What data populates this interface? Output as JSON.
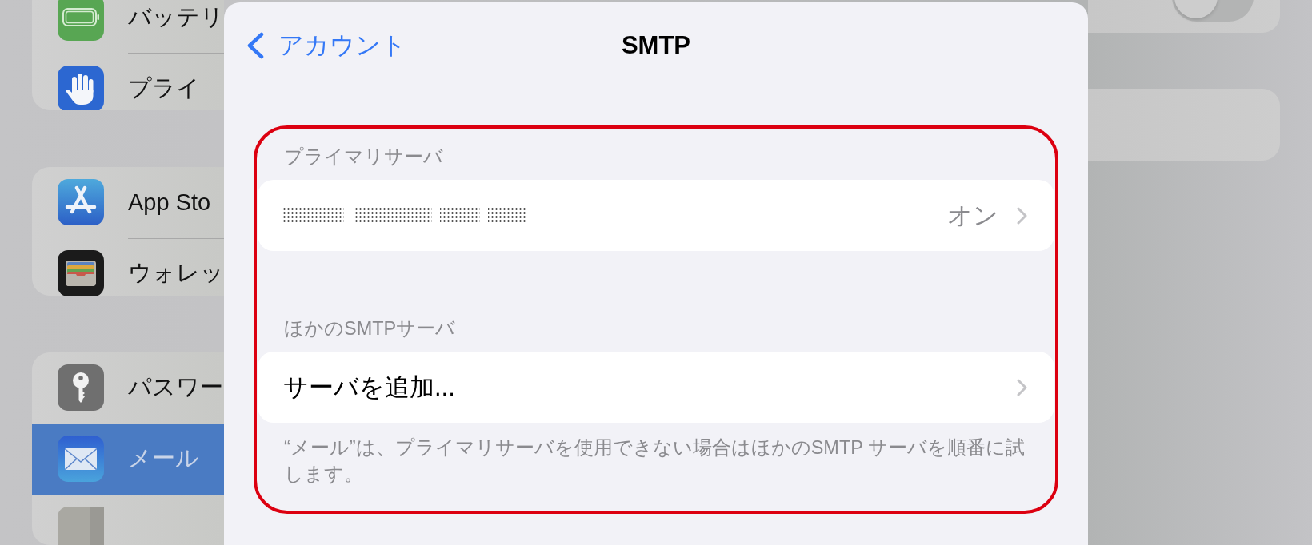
{
  "sidebar": {
    "groups": [
      {
        "items": [
          {
            "label": "バッテリ",
            "selected": false
          },
          {
            "label": "プライ",
            "selected": false
          }
        ]
      },
      {
        "items": [
          {
            "label": "App Sto",
            "selected": false
          },
          {
            "label": "ウォレッ",
            "selected": false
          }
        ]
      },
      {
        "items": [
          {
            "label": "パスワー",
            "selected": false
          },
          {
            "label": "メール",
            "selected": true
          },
          {
            "selected": false
          }
        ]
      }
    ]
  },
  "sheet": {
    "back_button": {
      "label": "アカウント"
    },
    "title": "SMTP",
    "sections": [
      {
        "header": "プライマリサーバ",
        "rows": [
          {
            "kind": "server",
            "value": "オン"
          }
        ]
      },
      {
        "header": "ほかのSMTPサーバ",
        "rows": [
          {
            "kind": "action",
            "label": "サーバを追加..."
          }
        ],
        "footer": "“メール”は、プライマリサーバを使用できない場合はほかのSMTP サーバを順番に試します。"
      }
    ]
  },
  "detail": {
    "cards": [
      {
        "kind": "toggle",
        "on": false
      },
      {
        "kind": "blank"
      }
    ]
  }
}
